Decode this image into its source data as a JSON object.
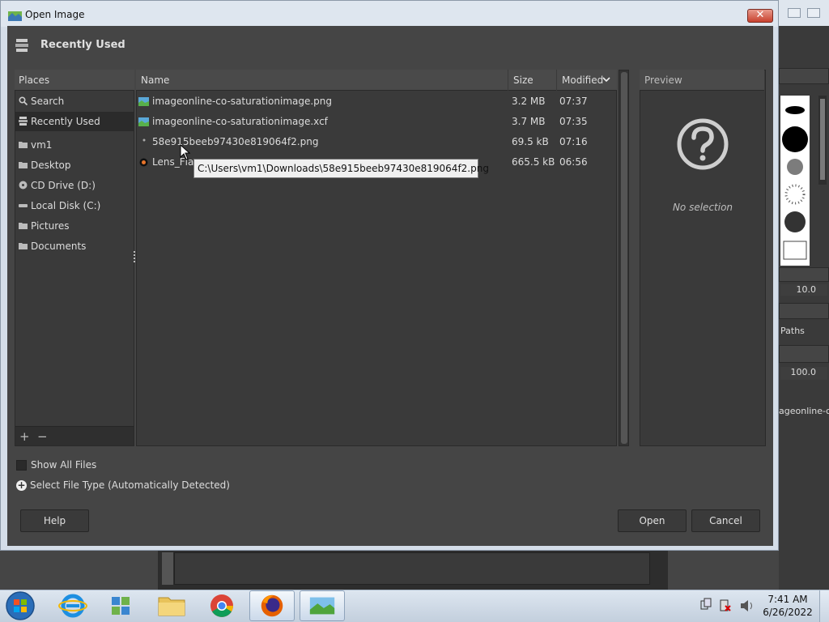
{
  "dialog": {
    "title": "Open Image",
    "close_glyph": "✕",
    "header": "Recently Used"
  },
  "places": {
    "header": "Places",
    "items": [
      {
        "label": "Search",
        "icon": "search-icon",
        "selected": false
      },
      {
        "label": "Recently Used",
        "icon": "recent-icon",
        "selected": true
      },
      {
        "label": "vm1",
        "icon": "folder-icon",
        "selected": false
      },
      {
        "label": "Desktop",
        "icon": "folder-icon",
        "selected": false
      },
      {
        "label": "CD Drive (D:)",
        "icon": "cd-drive-icon",
        "selected": false
      },
      {
        "label": "Local Disk (C:)",
        "icon": "disk-icon",
        "selected": false
      },
      {
        "label": "Pictures",
        "icon": "folder-icon",
        "selected": false
      },
      {
        "label": "Documents",
        "icon": "folder-icon",
        "selected": false
      }
    ],
    "add_glyph": "+",
    "remove_glyph": "−"
  },
  "files": {
    "columns": {
      "name": "Name",
      "size": "Size",
      "modified": "Modified"
    },
    "rows": [
      {
        "name": "imageonline-co-saturationimage.png",
        "size": "3.2 MB",
        "modified": "07:37",
        "icon": "image-file-icon"
      },
      {
        "name": "imageonline-co-saturationimage.xcf",
        "size": "3.7 MB",
        "modified": "07:35",
        "icon": "image-file-icon"
      },
      {
        "name": "58e915beeb97430e819064f2.png",
        "size": "69.5 kB",
        "modified": "07:16",
        "icon": "image-file-icon"
      },
      {
        "name": "Lens_Fla",
        "size": "665.5 kB",
        "modified": "06:56",
        "icon": "lens-flare-icon"
      }
    ]
  },
  "tooltip": "C:\\Users\\vm1\\Downloads\\58e915beeb97430e819064f2.png",
  "preview": {
    "header": "Preview",
    "empty_text": "No selection"
  },
  "options": {
    "show_all_files": "Show All Files",
    "select_file_type": "Select File Type (Automatically Detected)"
  },
  "buttons": {
    "help": "Help",
    "open": "Open",
    "cancel": "Cancel"
  },
  "gimp_bg": {
    "brush_size": "10.0",
    "paths_tab": "Paths",
    "opacity": "100.0",
    "layer_name": "ageonline-co-s"
  },
  "taskbar": {
    "time": "7:41 AM",
    "date": "6/26/2022",
    "items": [
      "start-button",
      "internet-explorer",
      "network-app",
      "file-explorer",
      "chrome",
      "firefox",
      "gimp"
    ]
  },
  "colors": {
    "dialog_bg": "#454545",
    "list_bg": "#3a3a3a",
    "close_red": "#c8412e"
  }
}
